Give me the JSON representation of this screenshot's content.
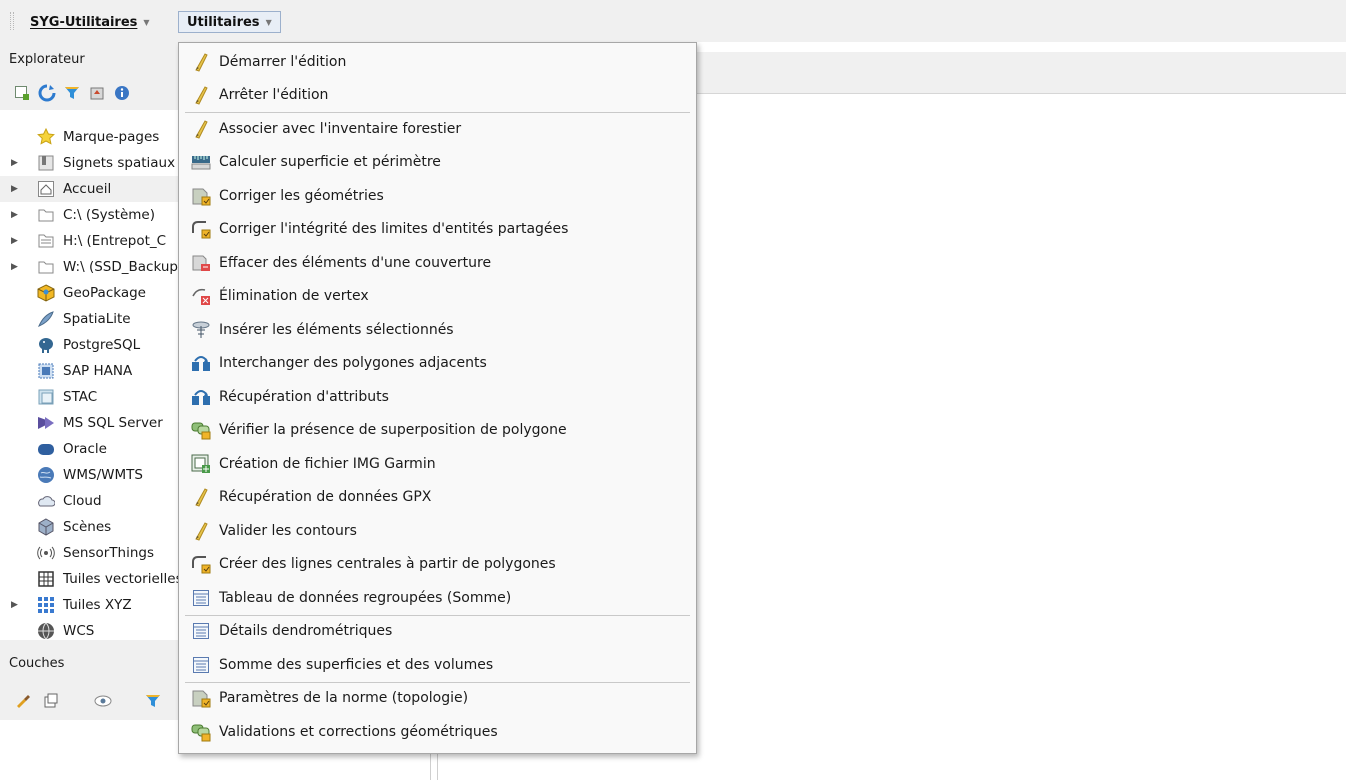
{
  "toolbar": {
    "menu1": "SYG-Utilitaires",
    "menu2": "Utilitaires"
  },
  "browser": {
    "title": "Explorateur",
    "tools": [
      "add-layer-icon",
      "refresh-icon",
      "filter-icon",
      "collapse-icon",
      "info-icon"
    ],
    "items": [
      {
        "label": "Marque-pages",
        "icon": "star-icon",
        "expandable": false
      },
      {
        "label": "Signets spatiaux",
        "icon": "spatial-bookmark-icon",
        "expandable": true
      },
      {
        "label": "Accueil",
        "icon": "home-icon",
        "expandable": true
      },
      {
        "label": "C:\\ (Système)",
        "icon": "drive-icon",
        "expandable": true
      },
      {
        "label": "H:\\ (Entrepot_C",
        "icon": "network-drive-icon",
        "expandable": true
      },
      {
        "label": "W:\\ (SSD_Backup",
        "icon": "drive-icon",
        "expandable": true
      },
      {
        "label": "GeoPackage",
        "icon": "geopackage-icon",
        "expandable": false
      },
      {
        "label": "SpatiaLite",
        "icon": "feather-icon",
        "expandable": false
      },
      {
        "label": "PostgreSQL",
        "icon": "elephant-icon",
        "expandable": false
      },
      {
        "label": "SAP HANA",
        "icon": "hana-icon",
        "expandable": false
      },
      {
        "label": "STAC",
        "icon": "stac-icon",
        "expandable": false
      },
      {
        "label": "MS SQL Server",
        "icon": "mssql-icon",
        "expandable": false
      },
      {
        "label": "Oracle",
        "icon": "oracle-icon",
        "expandable": false
      },
      {
        "label": "WMS/WMTS",
        "icon": "globe-icon",
        "expandable": false
      },
      {
        "label": "Cloud",
        "icon": "cloud-icon",
        "expandable": false
      },
      {
        "label": "Scènes",
        "icon": "cube-icon",
        "expandable": false
      },
      {
        "label": "SensorThings",
        "icon": "sensor-icon",
        "expandable": false
      },
      {
        "label": "Tuiles vectorielles",
        "icon": "grid-icon",
        "expandable": false
      },
      {
        "label": "Tuiles XYZ",
        "icon": "xyz-grid-icon",
        "expandable": true
      },
      {
        "label": "WCS",
        "icon": "wcs-globe-icon",
        "expandable": false
      }
    ]
  },
  "layers": {
    "title": "Couches",
    "tools": [
      "style-icon",
      "add-group-icon",
      "eye-icon",
      "filter-icon"
    ]
  },
  "menu": {
    "items": [
      {
        "label": "Démarrer l'édition",
        "icon": "pencil-icon"
      },
      {
        "label": "Arrêter l'édition",
        "icon": "pencil-icon"
      },
      {
        "label": "Associer avec l'inventaire forestier",
        "icon": "pencil-icon"
      },
      {
        "label": "Calculer superficie et périmètre",
        "icon": "measure-icon"
      },
      {
        "label": "Corriger les géométries",
        "icon": "fix-geometry-icon"
      },
      {
        "label": "Corriger l'intégrité des limites d'entités partagées",
        "icon": "fix-line-icon"
      },
      {
        "label": "Effacer des éléments d'une couverture",
        "icon": "erase-icon"
      },
      {
        "label": "Élimination de vertex",
        "icon": "vertex-delete-icon"
      },
      {
        "label": "Insérer les éléments sélectionnés",
        "icon": "insert-icon"
      },
      {
        "label": "Interchanger des polygones adjacents",
        "icon": "swap-polygon-icon"
      },
      {
        "label": "Récupération d'attributs",
        "icon": "swap-polygon-icon"
      },
      {
        "label": "Vérifier la présence de superposition de polygone",
        "icon": "overlap-icon"
      },
      {
        "label": "Création de fichier IMG Garmin",
        "icon": "garmin-icon"
      },
      {
        "label": "Récupération de données GPX",
        "icon": "pencil-icon"
      },
      {
        "label": "Valider les contours",
        "icon": "pencil-icon"
      },
      {
        "label": "Créer des lignes centrales à partir de polygones",
        "icon": "fix-line-icon"
      },
      {
        "label": "Tableau de données regroupées (Somme)",
        "icon": "table-icon"
      },
      {
        "label": "Détails dendrométriques",
        "icon": "table-icon"
      },
      {
        "label": "Somme des superficies et des volumes",
        "icon": "table-icon"
      },
      {
        "label": "Paramètres de la norme (topologie)",
        "icon": "fix-geometry-icon"
      },
      {
        "label": "Validations et corrections géométriques",
        "icon": "overlap-icon"
      }
    ]
  }
}
